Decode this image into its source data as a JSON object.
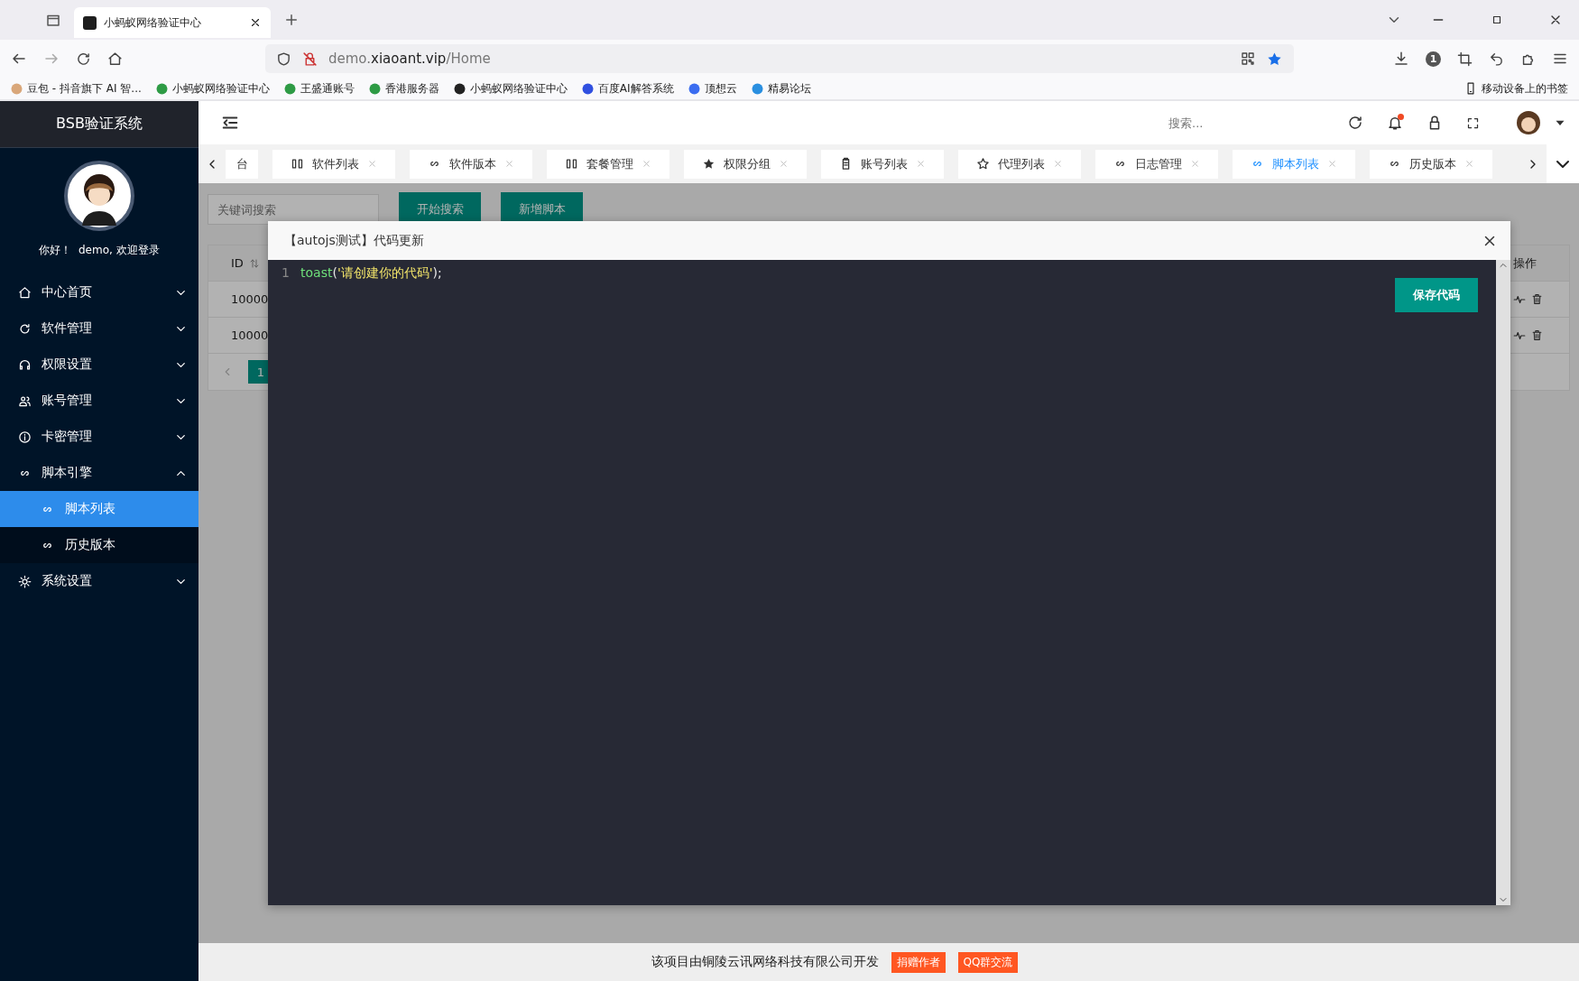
{
  "browser": {
    "tab_title": "小蚂蚁网络验证中心",
    "url": {
      "prefix": "demo.",
      "host": "xiaoant.vip",
      "path": "/Home"
    },
    "notification_count": "1",
    "mobile_bookmarks": "移动设备上的书签",
    "bookmarks": [
      {
        "kind": "avatar",
        "label": "豆包 - 抖音旗下 AI 智..."
      },
      {
        "kind": "shield",
        "label": "小蚂蚁网络验证中心"
      },
      {
        "kind": "shield",
        "label": "王盛通账号"
      },
      {
        "kind": "shield",
        "label": "香港服务器"
      },
      {
        "kind": "logo",
        "label": "小蚂蚁网络验证中心"
      },
      {
        "kind": "paw",
        "label": "百度AI解答系统"
      },
      {
        "kind": "cloud",
        "label": "顶想云"
      },
      {
        "kind": "eye",
        "label": "精易论坛"
      }
    ]
  },
  "sidebar": {
    "title": "BSB验证系统",
    "greeting": "你好！  demo, 欢迎登录",
    "menu": [
      {
        "kind": "home",
        "label": "中心首页",
        "expanded": false
      },
      {
        "kind": "cycle",
        "label": "软件管理",
        "expanded": false
      },
      {
        "kind": "headset",
        "label": "权限设置",
        "expanded": false
      },
      {
        "kind": "users",
        "label": "账号管理",
        "expanded": false
      },
      {
        "kind": "info",
        "label": "卡密管理",
        "expanded": false
      },
      {
        "kind": "link",
        "label": "脚本引擎",
        "expanded": true,
        "children": [
          {
            "kind": "link",
            "label": "脚本列表",
            "selected": true
          },
          {
            "kind": "link",
            "label": "历史版本",
            "selected": false
          }
        ]
      },
      {
        "kind": "gear",
        "label": "系统设置",
        "expanded": false
      }
    ]
  },
  "header": {
    "search_placeholder": "搜索..."
  },
  "tabs": [
    {
      "kind": "cut",
      "label": "台",
      "selected": false,
      "closable": false
    },
    {
      "kind": "columns",
      "label": "软件列表",
      "selected": false,
      "closable": true
    },
    {
      "kind": "link",
      "label": "软件版本",
      "selected": false,
      "closable": true
    },
    {
      "kind": "columns",
      "label": "套餐管理",
      "selected": false,
      "closable": true
    },
    {
      "kind": "starfill",
      "label": "权限分组",
      "selected": false,
      "closable": true
    },
    {
      "kind": "clipboard",
      "label": "账号列表",
      "selected": false,
      "closable": true
    },
    {
      "kind": "star",
      "label": "代理列表",
      "selected": false,
      "closable": true
    },
    {
      "kind": "link",
      "label": "日志管理",
      "selected": false,
      "closable": true
    },
    {
      "kind": "link",
      "label": "脚本列表",
      "selected": true,
      "closable": true
    },
    {
      "kind": "link",
      "label": "历史版本",
      "selected": false,
      "closable": true
    }
  ],
  "page": {
    "search_placeholder": "关键词搜索",
    "buttons": [
      "开始搜索",
      "新增脚本"
    ],
    "table": {
      "columns": [
        "ID",
        "操作"
      ],
      "rows": [
        {
          "id": "10000"
        },
        {
          "id": "10000"
        }
      ]
    },
    "pager": [
      {
        "label": "1",
        "selected": true
      }
    ]
  },
  "modal": {
    "title": "【autojs测试】代码更新",
    "save_button": "保存代码",
    "lines": [
      {
        "number": "1",
        "tokens": [
          {
            "kind": "func",
            "text": "toast"
          },
          {
            "kind": "punct",
            "text": "("
          },
          {
            "kind": "string",
            "text": "'请创建你的代码'"
          },
          {
            "kind": "punct",
            "text": ");"
          }
        ]
      }
    ]
  },
  "footer": {
    "text": "该项目由铜陵云讯网络科技有限公司开发",
    "badges": [
      "捐赠作者",
      "QQ群交流"
    ]
  }
}
